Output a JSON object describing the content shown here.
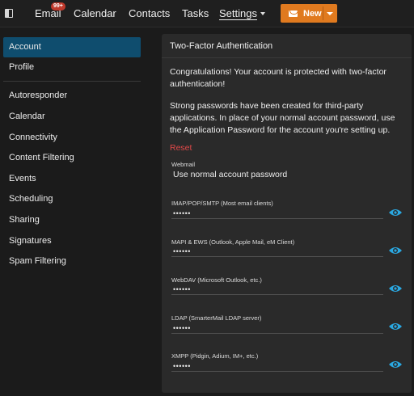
{
  "topbar": {
    "nav": {
      "email": "Email",
      "email_badge": "99+",
      "calendar": "Calendar",
      "contacts": "Contacts",
      "tasks": "Tasks",
      "settings": "Settings"
    },
    "new_button": "New",
    "accent_color": "#e07a1f"
  },
  "sidebar": {
    "items": [
      {
        "label": "Account",
        "active": true
      },
      {
        "label": "Profile"
      },
      {
        "label": "Autoresponder"
      },
      {
        "label": "Calendar"
      },
      {
        "label": "Connectivity"
      },
      {
        "label": "Content Filtering"
      },
      {
        "label": "Events"
      },
      {
        "label": "Scheduling"
      },
      {
        "label": "Sharing"
      },
      {
        "label": "Signatures"
      },
      {
        "label": "Spam Filtering"
      }
    ],
    "active_color": "#0f4d6e"
  },
  "panel": {
    "title": "Two-Factor Authentication",
    "congrats": "Congratulations! Your account is protected with two-factor authentication!",
    "info": "Strong passwords have been created for third-party applications. In place of your normal account password, use the Application Password for the account you're setting up.",
    "reset": "Reset",
    "fields": [
      {
        "label": "Webmail",
        "value": "Use normal account password"
      },
      {
        "label": "IMAP/POP/SMTP (Most email clients)",
        "value": "••••••",
        "icon": "eye-icon"
      },
      {
        "label": "MAPI & EWS (Outlook, Apple Mail, eM Client)",
        "value": "••••••",
        "icon": "eye-icon"
      },
      {
        "label": "WebDAV (Microsoft Outlook, etc.)",
        "value": "••••••",
        "icon": "eye-icon"
      },
      {
        "label": "LDAP (SmarterMail LDAP server)",
        "value": "••••••",
        "icon": "eye-icon"
      },
      {
        "label": "XMPP (Pidgin, Adium, IM+, etc.)",
        "value": "••••••",
        "icon": "eye-icon"
      }
    ],
    "eye_color": "#2aa7e0"
  }
}
